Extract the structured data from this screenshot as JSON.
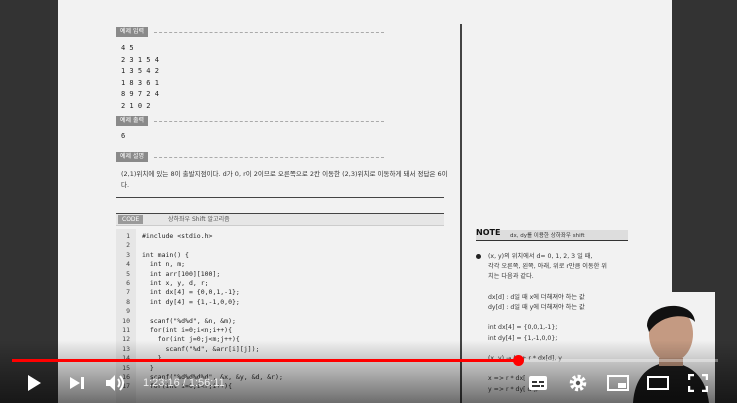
{
  "page": {
    "sample_input_label": "예제 입력",
    "sample_input_lines": [
      "4 5",
      "2 3 1 5 4",
      "1 3 5 4 2",
      "1 8 3 6 1",
      "8 9 7 2 4",
      "2 1 0 2"
    ],
    "sample_output_label": "예제 출력",
    "sample_output_value": "6",
    "explain_label": "예제 설명",
    "explain_text": "(2,1)위치에 있는 8이 출발지점이다. d가 0, r이 2이므로 오른쪽으로 2칸 이동한 (2,3)위치로 이동하게 돼서 정답은 6이다.",
    "code_label": "CODE",
    "code_title": "상하좌우 Shift 알고리즘",
    "code_lines": [
      {
        "n": "1",
        "t": "#include <stdio.h>"
      },
      {
        "n": "2",
        "t": ""
      },
      {
        "n": "3",
        "t": "int main() {"
      },
      {
        "n": "4",
        "t": "  int n, m;"
      },
      {
        "n": "5",
        "t": "  int arr[100][100];"
      },
      {
        "n": "6",
        "t": "  int x, y, d, r;"
      },
      {
        "n": "7",
        "t": "  int dx[4] = {0,0,1,-1};"
      },
      {
        "n": "8",
        "t": "  int dy[4] = {1,-1,0,0};"
      },
      {
        "n": "9",
        "t": ""
      },
      {
        "n": "10",
        "t": "  scanf(\"%d%d\", &n, &m);"
      },
      {
        "n": "11",
        "t": "  for(int i=0;i<n;i++){"
      },
      {
        "n": "12",
        "t": "    for(int j=0;j<m;j++){"
      },
      {
        "n": "13",
        "t": "      scanf(\"%d\", &arr[i][j]);"
      },
      {
        "n": "14",
        "t": "    }"
      },
      {
        "n": "15",
        "t": "  }"
      },
      {
        "n": "16",
        "t": "  scanf(\"%d%d%d%d\", &x, &y, &d, &r);"
      },
      {
        "n": "17",
        "t": "  for(int i=0;i<r;i++){"
      }
    ],
    "note_big": "NOTE",
    "note_sub": "dx, dy를 이용한 상하좌우 shift",
    "note_lines": [
      "(x, y)의 위치에서 d= 0, 1, 2, 3 일 때,",
      "각각 오른쪽, 왼쪽, 아래, 위로 r만큼 이동한 위",
      "치는 다음과 같다.",
      "",
      "dx[d] : d일 때 x에 더해져야 하는 값",
      "dy[d] : d일 때 y에 더해져야 하는 값",
      "",
      "int dx[4] = {0,0,1,-1};",
      "int dy[4] = {1,-1,0,0};",
      "",
      "(x, y) → (x + r * dx[d], y",
      "",
      "x => r * dx[",
      "y => r * dy[ d ],"
    ]
  },
  "player": {
    "time_display": "1:23:16 / 1:56:11",
    "progress_fraction": 0.7163,
    "accent": "#ff0000"
  },
  "icons": [
    "play-icon",
    "next-icon",
    "volume-icon",
    "subtitles-icon",
    "settings-icon",
    "miniplayer-icon",
    "theater-icon",
    "fullscreen-icon"
  ]
}
